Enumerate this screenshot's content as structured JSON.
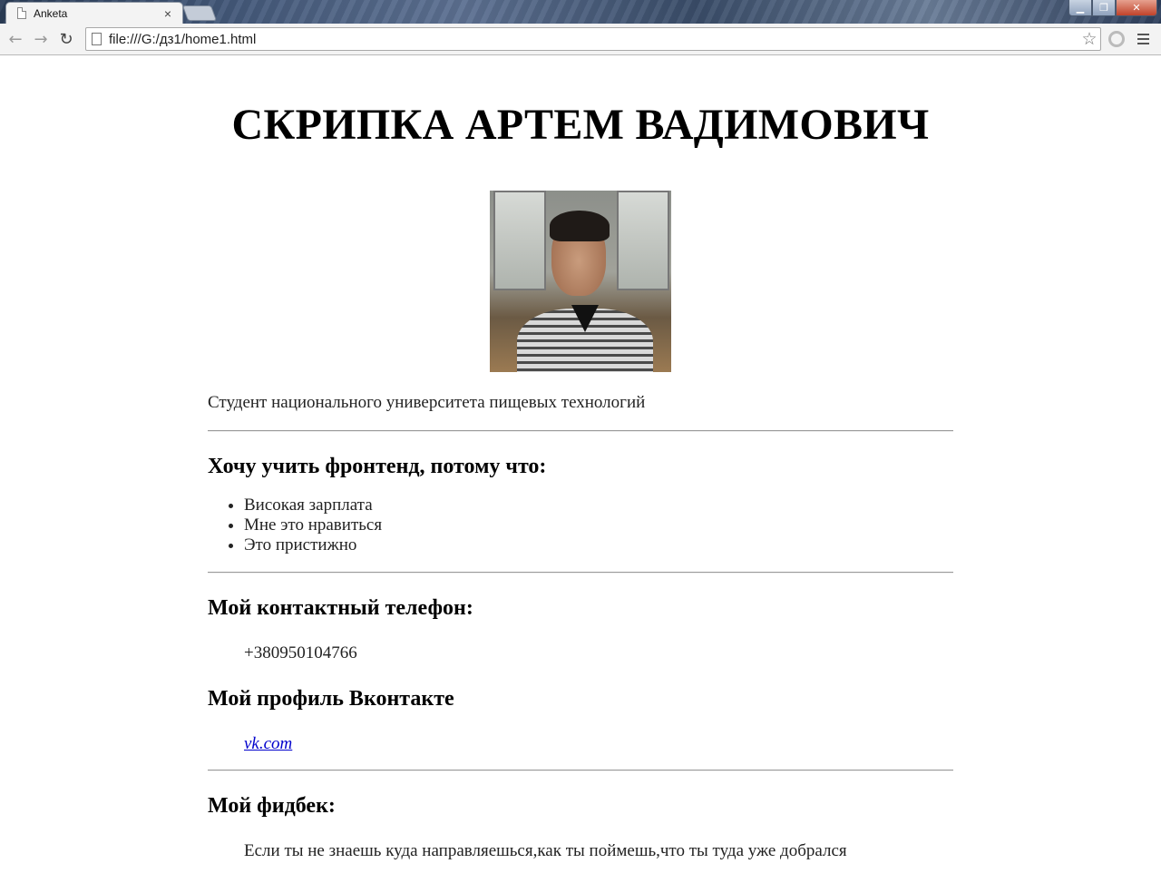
{
  "browser": {
    "tab_title": "Anketa",
    "tab_close": "×",
    "url": "file:///G:/дз1/home1.html",
    "icons": {
      "back": "back-arrow-icon",
      "forward": "forward-arrow-icon",
      "reload": "reload-icon",
      "bookmark": "star-icon",
      "menu": "menu-icon"
    }
  },
  "page": {
    "title": "СКРИПКА АРТЕМ ВАДИМОВИЧ",
    "subtitle": "Студент национального университета пищевых технологий",
    "why": {
      "heading": "Хочу учить фронтенд, потому что:",
      "items": [
        "Високая зарплата",
        "Мне это нравиться",
        "Это пристижно"
      ]
    },
    "phone": {
      "heading": "Мой контактный телефон:",
      "value": "+380950104766"
    },
    "vk": {
      "heading": "Мой профиль Вконтакте",
      "link_text": "vk.com"
    },
    "feedback": {
      "heading": "Мой фидбек:",
      "text": "Если ты не знаешь куда направляешься,как ты поймешь,что ты туда уже добрался"
    }
  }
}
